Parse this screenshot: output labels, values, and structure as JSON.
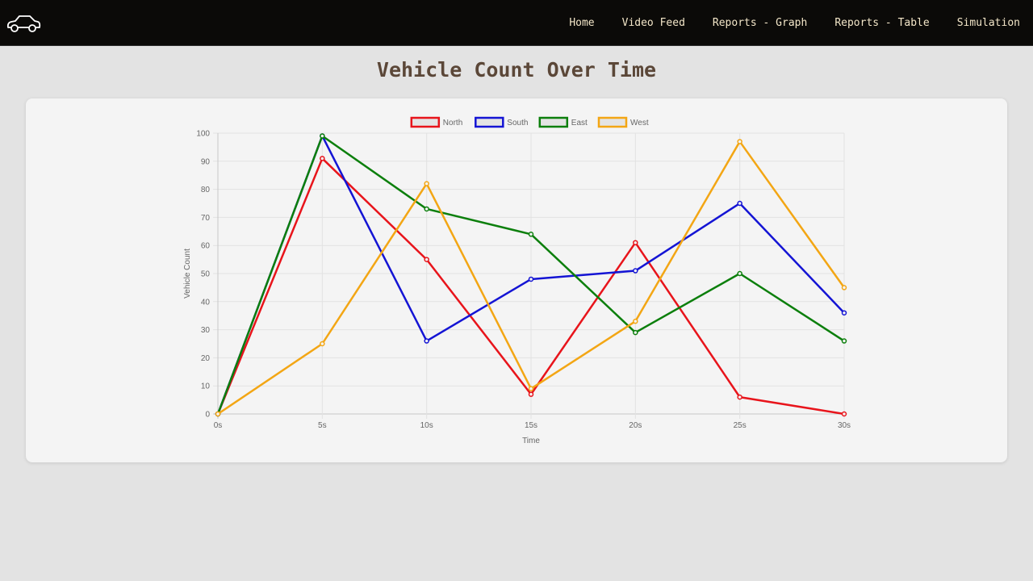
{
  "nav": {
    "logo_icon": "car-icon",
    "links": [
      "Home",
      "Video Feed",
      "Reports - Graph",
      "Reports - Table",
      "Simulation"
    ]
  },
  "page": {
    "title": "Vehicle Count Over Time"
  },
  "chart_data": {
    "type": "line",
    "title": "",
    "xlabel": "Time",
    "ylabel": "Vehicle Count",
    "categories": [
      "0s",
      "5s",
      "10s",
      "15s",
      "20s",
      "25s",
      "30s"
    ],
    "ylim": [
      0,
      100
    ],
    "yticks": [
      0,
      10,
      20,
      30,
      40,
      50,
      60,
      70,
      80,
      90,
      100
    ],
    "grid": true,
    "legend_position": "top",
    "series": [
      {
        "name": "North",
        "color": "#e8141b",
        "values": [
          0,
          91,
          55,
          7,
          61,
          6,
          0
        ]
      },
      {
        "name": "South",
        "color": "#1414d4",
        "values": [
          0,
          99,
          26,
          48,
          51,
          75,
          36
        ]
      },
      {
        "name": "East",
        "color": "#0c7f0c",
        "values": [
          0,
          99,
          73,
          64,
          29,
          50,
          26
        ]
      },
      {
        "name": "West",
        "color": "#f3a614",
        "values": [
          0,
          25,
          82,
          9,
          33,
          97,
          45
        ]
      }
    ]
  }
}
